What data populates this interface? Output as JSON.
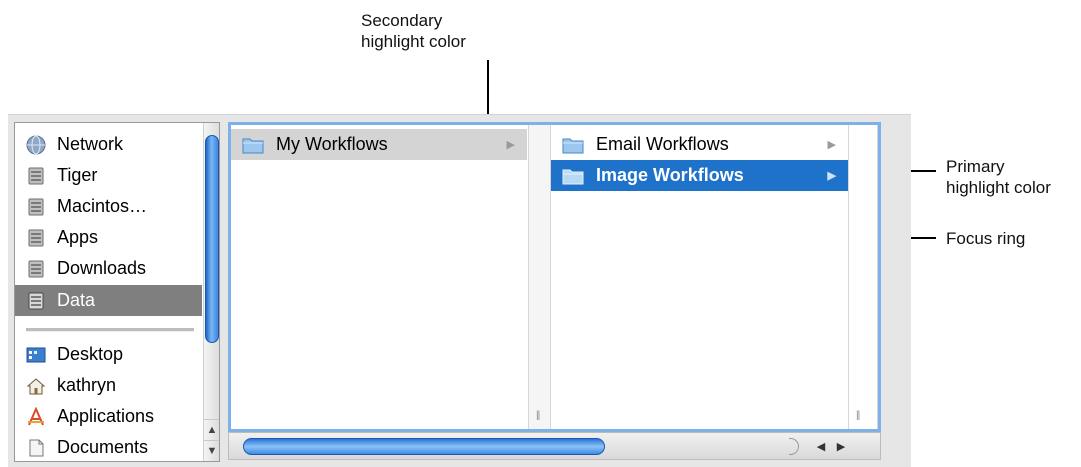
{
  "callouts": {
    "secondary": {
      "line1": "Secondary",
      "line2": "highlight color"
    },
    "primary": {
      "line1": "Primary",
      "line2": "highlight color"
    },
    "focus": {
      "line1": "Focus ring"
    }
  },
  "sidebar": {
    "devices": [
      {
        "label": "Network",
        "icon": "network-globe-icon"
      },
      {
        "label": "Tiger",
        "icon": "hard-drive-icon"
      },
      {
        "label": "Macintos…",
        "icon": "hard-drive-icon"
      },
      {
        "label": "Apps",
        "icon": "hard-drive-icon"
      },
      {
        "label": "Downloads",
        "icon": "hard-drive-icon"
      },
      {
        "label": "Data",
        "icon": "hard-drive-icon",
        "selected": true
      }
    ],
    "places": [
      {
        "label": "Desktop",
        "icon": "desktop-icon"
      },
      {
        "label": "kathryn",
        "icon": "home-icon"
      },
      {
        "label": "Applications",
        "icon": "applications-icon"
      },
      {
        "label": "Documents",
        "icon": "document-icon"
      }
    ]
  },
  "browser": {
    "column1": [
      {
        "label": "My Workflows",
        "highlight": "secondary"
      }
    ],
    "column2": [
      {
        "label": "Email Workflows",
        "highlight": "none"
      },
      {
        "label": "Image Workflows",
        "highlight": "primary"
      }
    ]
  },
  "colors": {
    "primary_highlight": "#1f72c9",
    "secondary_highlight": "#d4d4d4",
    "focus_ring": "#7fb0e8",
    "sidebar_selected": "#7f7f7f"
  }
}
